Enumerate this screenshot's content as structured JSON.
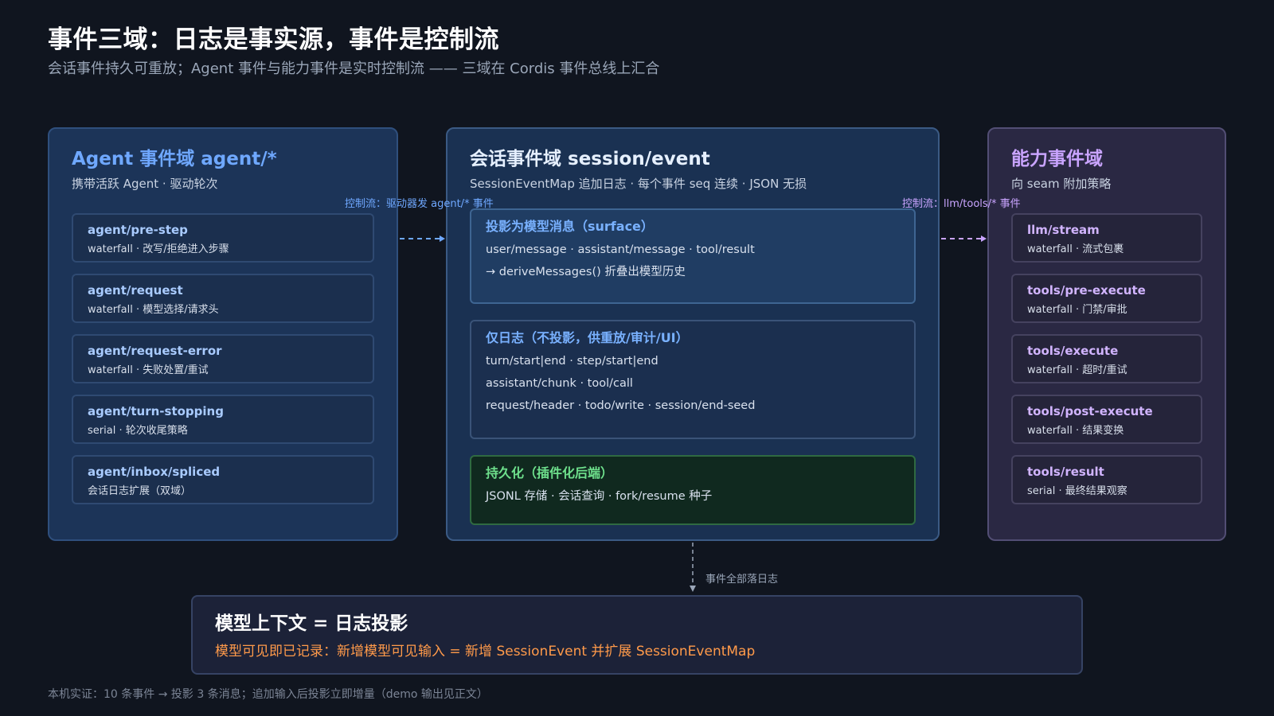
{
  "header": {
    "title": "事件三域：日志是事实源，事件是控制流",
    "subtitle": "会话事件持久可重放；Agent 事件与能力事件是实时控制流 —— 三域在 Cordis 事件总线上汇合"
  },
  "agent_domain": {
    "title": "Agent 事件域 agent/*",
    "desc": "携带活跃 Agent · 驱动轮次",
    "events": [
      {
        "name": "agent/pre-step",
        "desc": "waterfall · 改写/拒绝进入步骤"
      },
      {
        "name": "agent/request",
        "desc": "waterfall · 模型选择/请求头"
      },
      {
        "name": "agent/request-error",
        "desc": "waterfall · 失败处置/重试"
      },
      {
        "name": "agent/turn-stopping",
        "desc": "serial · 轮次收尾策略"
      },
      {
        "name": "agent/inbox/spliced",
        "desc": "会话日志扩展（双域）"
      }
    ]
  },
  "session_domain": {
    "title": "会话事件域 session/event",
    "desc": "SessionEventMap 追加日志 · 每个事件 seq 连续 · JSON 无损",
    "surface": {
      "title": "投影为模型消息（surface）",
      "lines": [
        "user/message · assistant/message · tool/result",
        "→ deriveMessages() 折叠出模型历史"
      ]
    },
    "log_only": {
      "title": "仅日志（不投影，供重放/审计/UI）",
      "lines": [
        "turn/start|end · step/start|end",
        "assistant/chunk · tool/call",
        "request/header · todo/write · session/end-seed"
      ]
    },
    "persist": {
      "title": "持久化（插件化后端）",
      "lines": [
        "JSONL 存储 · 会话查询 · fork/resume 种子"
      ]
    }
  },
  "capability_domain": {
    "title": "能力事件域",
    "desc": "向 seam 附加策略",
    "events": [
      {
        "name": "llm/stream",
        "desc": "waterfall · 流式包裹"
      },
      {
        "name": "tools/pre-execute",
        "desc": "waterfall · 门禁/审批"
      },
      {
        "name": "tools/execute",
        "desc": "waterfall · 超时/重试"
      },
      {
        "name": "tools/post-execute",
        "desc": "waterfall · 结果变换"
      },
      {
        "name": "tools/result",
        "desc": "serial · 最终结果观察"
      }
    ]
  },
  "flows": {
    "agent_to_session": "控制流：驱动器发 agent/* 事件",
    "session_to_cap": "控制流：llm/tools/* 事件",
    "session_to_context": "事件全部落日志"
  },
  "context": {
    "title": "模型上下文 = 日志投影",
    "subtitle": "模型可见即已记录：新增模型可见输入 = 新增 SessionEvent 并扩展 SessionEventMap"
  },
  "footer": "本机实证：10 条事件 → 投影 3 条消息；追加输入后投影立即增量（demo 输出见正文）",
  "colors": {
    "background": "#10151f",
    "agent_accent": "#6fa8ff",
    "capability_accent": "#c9a4ff",
    "persist_accent": "#6ee08c",
    "context_accent": "#ff9a4a"
  }
}
